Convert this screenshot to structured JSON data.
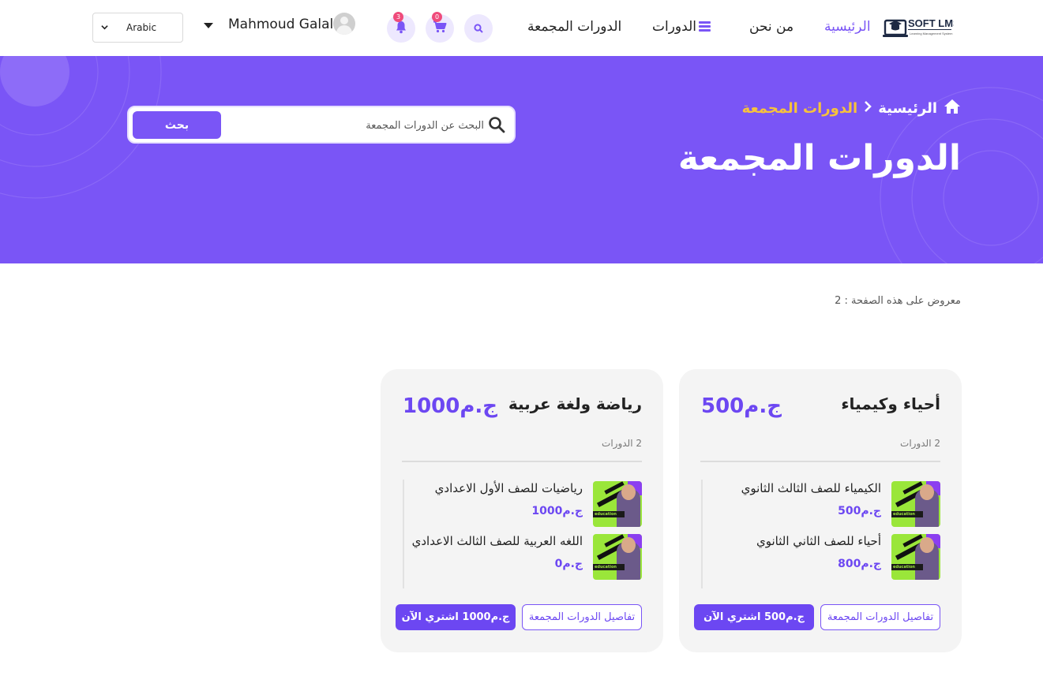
{
  "header": {
    "language_select": {
      "value": "Arabic"
    },
    "user_name": "Mahmoud Galal",
    "cart_badge": "0",
    "notifications_badge": "3",
    "nav": {
      "home": "الرئيسية",
      "about": "من نحن",
      "courses": "الدورات",
      "bundles": "الدورات المجمعة"
    },
    "logo": {
      "title": "SOFT LMS",
      "subtitle": "Learning Management System"
    }
  },
  "hero": {
    "breadcrumb": {
      "home": "الرئيسية",
      "current": "الدورات المجمعة"
    },
    "title": "الدورات المجمعة",
    "search": {
      "placeholder": "البحث عن الدورات المجمعة",
      "button_label": "بحث"
    }
  },
  "listing": {
    "count_label": "معروض على هذه الصفحة : 2"
  },
  "bundles": [
    {
      "title": "أحياء وكيمياء",
      "price": "ج.م500",
      "course_count": "2 الدورات",
      "courses": [
        {
          "name": "الكيمياء للصف الثالث الثانوي",
          "price": "ج.م500"
        },
        {
          "name": "أحياء للصف الثاني الثانوي",
          "price": "ج.م800"
        }
      ],
      "details_button": "تفاصيل الدورات المجمعة",
      "buy_button": "ج.م500 اشتري الآن"
    },
    {
      "title": "رياضة ولغة عربية",
      "price": "ج.م1000",
      "course_count": "2 الدورات",
      "courses": [
        {
          "name": "رياضيات للصف الأول الاعدادي",
          "price": "ج.م1000"
        },
        {
          "name": "اللغه العربية للصف الثالث الاعدادي",
          "price": "ج.م0"
        }
      ],
      "details_button": "تفاصيل الدورات المجمعة",
      "buy_button": "ج.م1000 اشتري الآن"
    }
  ],
  "thumbnail_caption": "education",
  "colors": {
    "primary": "#7a55f6",
    "price": "#6c47f2",
    "breadcrumb_current": "#f7c23c",
    "badge": "#ef4b7b",
    "card_bg": "#f4f4f4"
  },
  "icons": {
    "search": "search-icon",
    "cart": "cart-icon",
    "notifications": "bell-icon",
    "menu": "menu-icon",
    "home": "home-icon",
    "breadcrumb_separator": "chevron-right-icon",
    "language_dropdown": "chevron-down-icon",
    "user_menu": "caret-down-icon"
  }
}
